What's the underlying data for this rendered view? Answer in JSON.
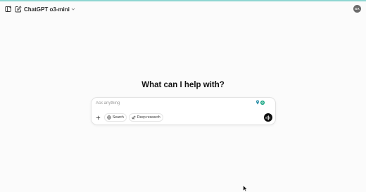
{
  "header": {
    "model_name": "ChatGPT o3-mini",
    "avatar_initials": "SA"
  },
  "main": {
    "headline": "What can I help with?"
  },
  "composer": {
    "placeholder": "Ask anything",
    "tools": [
      {
        "label": "Search",
        "icon": "globe-icon"
      },
      {
        "label": "Deep research",
        "icon": "telescope-icon"
      }
    ]
  },
  "colors": {
    "accent_bar": "#8fd6d2",
    "extension_green": "#10a37f",
    "voice_button": "#0d0d0d"
  }
}
